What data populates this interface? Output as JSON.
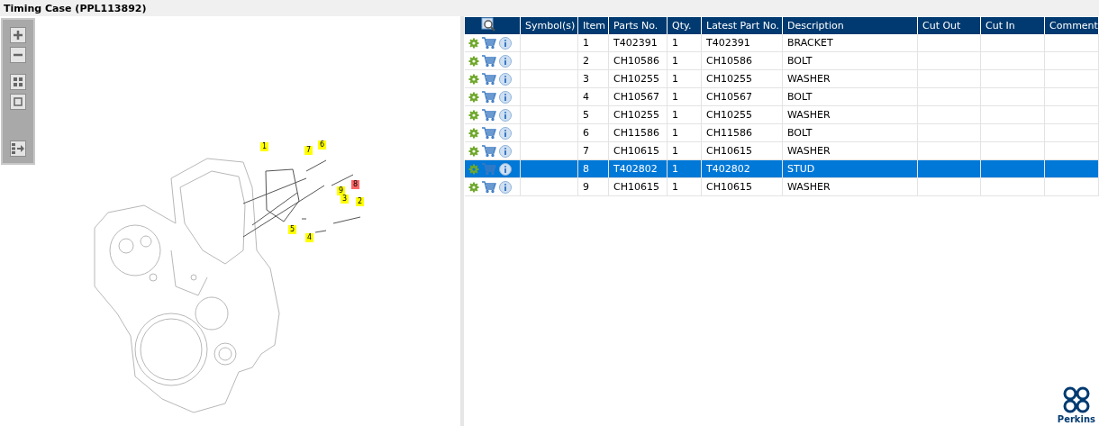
{
  "window": {
    "title": "Timing Case (PPL113892)"
  },
  "callouts": [
    {
      "label": "1",
      "selected": false
    },
    {
      "label": "7",
      "selected": false
    },
    {
      "label": "6",
      "selected": false
    },
    {
      "label": "8",
      "selected": true
    },
    {
      "label": "9",
      "selected": false
    },
    {
      "label": "3",
      "selected": false
    },
    {
      "label": "2",
      "selected": false
    },
    {
      "label": "5",
      "selected": false
    },
    {
      "label": "4",
      "selected": false
    }
  ],
  "table": {
    "columns": [
      "Symbol(s)",
      "Item",
      "Parts No.",
      "Qty.",
      "Latest Part No.",
      "Description",
      "Cut Out",
      "Cut In",
      "Comment"
    ],
    "rows": [
      {
        "item": "1",
        "part_no": "T402391",
        "qty": "1",
        "latest_part_no": "T402391",
        "description": "BRACKET",
        "selected": false
      },
      {
        "item": "2",
        "part_no": "CH10586",
        "qty": "1",
        "latest_part_no": "CH10586",
        "description": "BOLT",
        "selected": false
      },
      {
        "item": "3",
        "part_no": "CH10255",
        "qty": "1",
        "latest_part_no": "CH10255",
        "description": "WASHER",
        "selected": false
      },
      {
        "item": "4",
        "part_no": "CH10567",
        "qty": "1",
        "latest_part_no": "CH10567",
        "description": "BOLT",
        "selected": false
      },
      {
        "item": "5",
        "part_no": "CH10255",
        "qty": "1",
        "latest_part_no": "CH10255",
        "description": "WASHER",
        "selected": false
      },
      {
        "item": "6",
        "part_no": "CH11586",
        "qty": "1",
        "latest_part_no": "CH11586",
        "description": "BOLT",
        "selected": false
      },
      {
        "item": "7",
        "part_no": "CH10615",
        "qty": "1",
        "latest_part_no": "CH10615",
        "description": "WASHER",
        "selected": false
      },
      {
        "item": "8",
        "part_no": "T402802",
        "qty": "1",
        "latest_part_no": "T402802",
        "description": "STUD",
        "selected": true
      },
      {
        "item": "9",
        "part_no": "CH10615",
        "qty": "1",
        "latest_part_no": "CH10615",
        "description": "WASHER",
        "selected": false
      }
    ]
  },
  "logo": {
    "text": "Perkins"
  }
}
